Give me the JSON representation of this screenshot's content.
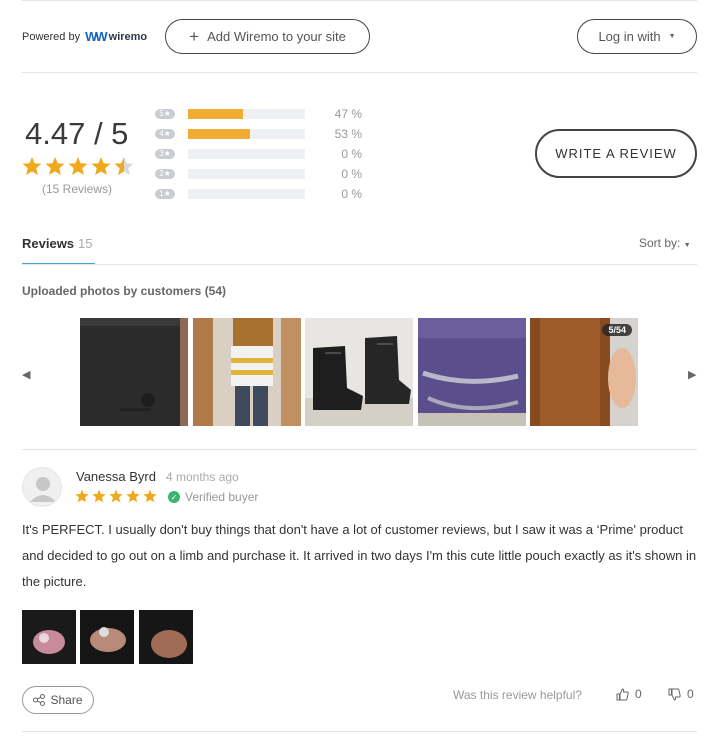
{
  "header": {
    "powered_label": "Powered by",
    "brand": "wiremo",
    "add_button": "Add Wiremo to your site",
    "login_button": "Log in with"
  },
  "summary": {
    "average": "4.47 / 5",
    "average_value": 4.47,
    "review_count": "(15 Reviews)",
    "write_button": "WRITE A REVIEW",
    "distribution": [
      {
        "badge": "5★",
        "fraction": 0.47,
        "pct": "47 %"
      },
      {
        "badge": "4★",
        "fraction": 0.53,
        "pct": "53 %"
      },
      {
        "badge": "3★",
        "fraction": 0,
        "pct": "0 %"
      },
      {
        "badge": "2★",
        "fraction": 0,
        "pct": "0 %"
      },
      {
        "badge": "1★",
        "fraction": 0,
        "pct": "0 %"
      }
    ]
  },
  "tabs": {
    "reviews_label": "Reviews",
    "reviews_count": "15",
    "sort_label": "Sort by:"
  },
  "photos": {
    "title": "Uploaded photos by customers (54)",
    "counter": "5/54"
  },
  "review": {
    "author": "Vanessa Byrd",
    "time": "4 months ago",
    "rating": 5,
    "verified": "Verified buyer",
    "text": "It's PERFECT. I usually don't buy things that don't have a lot of customer reviews, but I saw it was a ‘Prime' product and decided to go out on a limb and purchase it. It arrived in two days I'm this cute little pouch exactly as it's shown in the picture.",
    "share": "Share",
    "helpful_question": "Was this review helpful?",
    "upvotes": "0",
    "downvotes": "0"
  },
  "colors": {
    "accent_star": "#f0a91f",
    "bar_fill": "#f0ac33",
    "tab_underline": "#4aa3df",
    "verified_green": "#3cb371"
  }
}
